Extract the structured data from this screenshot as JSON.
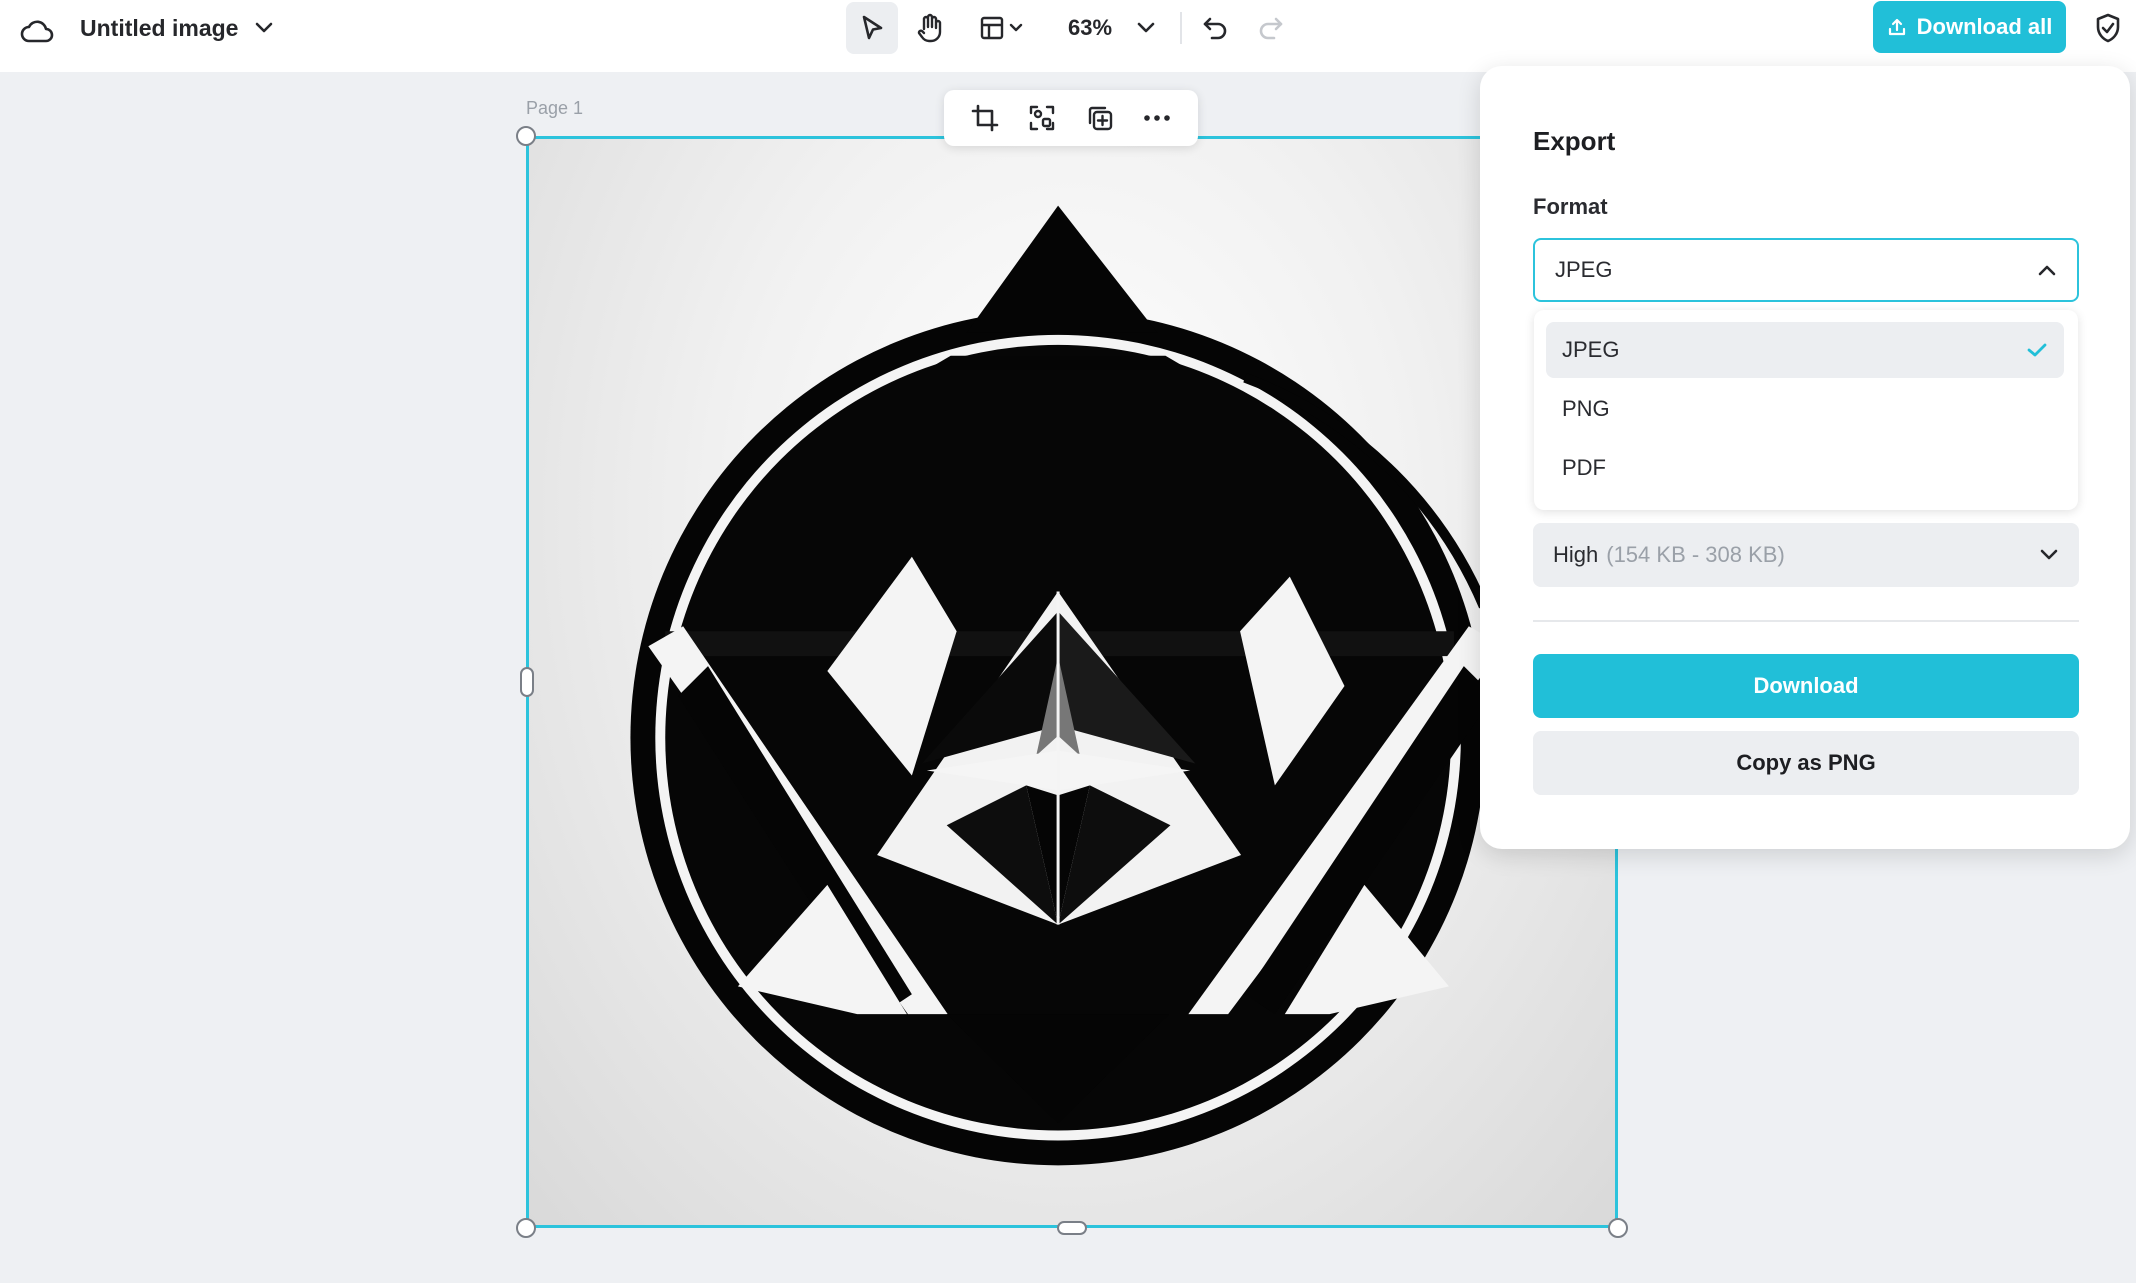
{
  "header": {
    "document_title": "Untitled image",
    "zoom": "63%",
    "download_all_label": "Download all"
  },
  "canvas": {
    "page_label": "Page 1"
  },
  "export_panel": {
    "title": "Export",
    "format_label": "Format",
    "format_selected": "JPEG",
    "format_options": [
      "JPEG",
      "PNG",
      "PDF"
    ],
    "quality_label": "High",
    "quality_size_range": "(154 KB - 308 KB)",
    "download_label": "Download",
    "copy_label": "Copy as PNG"
  },
  "colors": {
    "accent": "#21bfd8",
    "selection_border": "#2cc3dc"
  },
  "icons": {
    "cloud": "cloud-icon",
    "select": "pointer-icon",
    "hand": "hand-icon",
    "layout": "layout-icon",
    "undo": "undo-icon",
    "redo": "redo-icon",
    "shield": "shield-check-icon",
    "crop": "crop-icon",
    "replace": "replace-icon",
    "duplicate": "duplicate-icon",
    "more": "more-icon"
  }
}
